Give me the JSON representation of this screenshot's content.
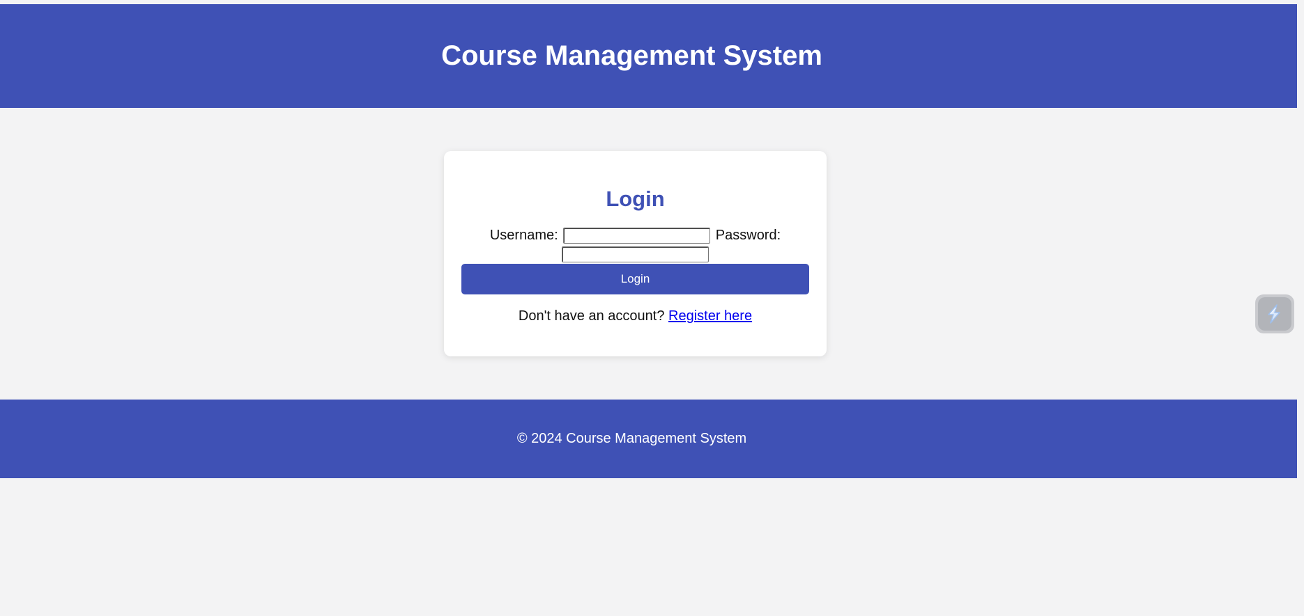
{
  "header": {
    "title": "Course Management System"
  },
  "login_card": {
    "title": "Login",
    "username_label": "Username:",
    "username_value": "",
    "password_label": "Password:",
    "password_value": "",
    "submit_label": "Login",
    "register_prompt": "Don't have an account?",
    "register_link": "Register here"
  },
  "footer": {
    "text": "© 2024 Course Management System"
  },
  "side_widget": {
    "icon": "lightning-bolt-icon"
  },
  "colors": {
    "brand": "#3f51b5",
    "background": "#f3f3f4",
    "card": "#ffffff",
    "link": "#0000ee"
  }
}
